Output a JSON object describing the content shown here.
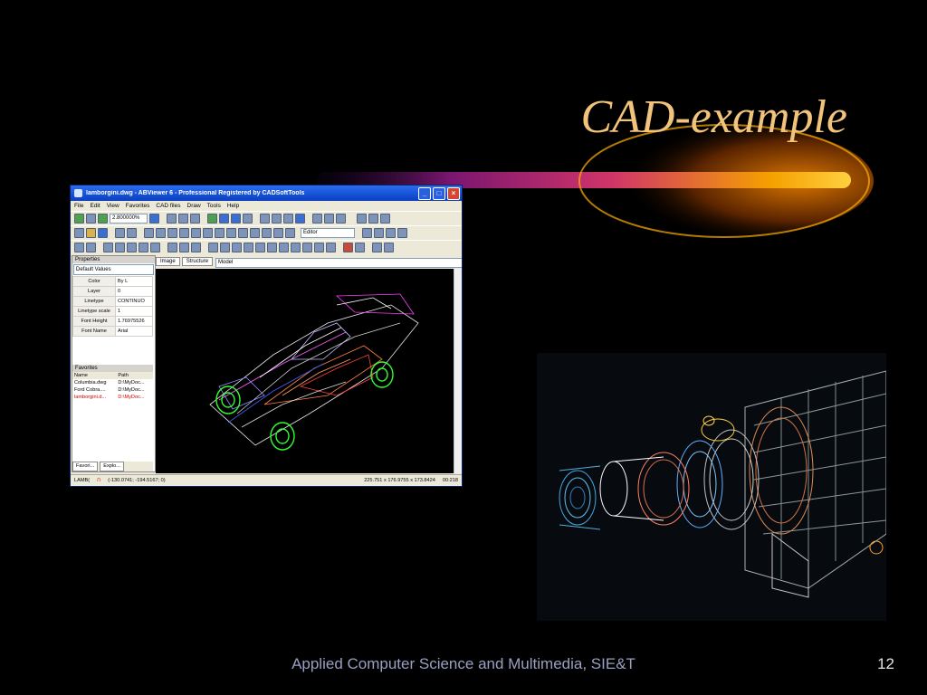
{
  "slide": {
    "title": "CAD-example",
    "footer": "Applied Computer Science and Multimedia, SIE&T",
    "page_number": "12"
  },
  "abviewer": {
    "window_title": "lamborgini.dwg - ABViewer 6 - Professional Registered by CADSoftTools",
    "menu": [
      "File",
      "Edit",
      "View",
      "Favorites",
      "CAD files",
      "Draw",
      "Tools",
      "Help"
    ],
    "zoom_value": "2.800000%",
    "mode_value": "Editor",
    "layout_value": "Model",
    "properties_header": "Properties",
    "properties_selector": "Default Values",
    "properties": [
      {
        "key": "Color",
        "value": "By L"
      },
      {
        "key": "Layer",
        "value": "0"
      },
      {
        "key": "Linetype",
        "value": "CONTINUO"
      },
      {
        "key": "Linetype scale",
        "value": "1"
      },
      {
        "key": "Font Height",
        "value": "1.76975526"
      },
      {
        "key": "Font Name",
        "value": "Arial"
      }
    ],
    "favorites_header": "Favorites",
    "favorites_columns": [
      "Name",
      "Path"
    ],
    "favorites_rows": [
      {
        "name": "Columbia.dwg",
        "path": "D:\\MyDoc..."
      },
      {
        "name": "Ford Cobra....",
        "path": "D:\\MyDoc..."
      },
      {
        "name": "lamborgini.d...",
        "path": "D:\\MyDoc..."
      }
    ],
    "bottom_tabs": [
      "Favori...",
      "Explo..."
    ],
    "drawing_tabs": [
      "Image",
      "Structure"
    ],
    "status_left": "LAMB(",
    "status_coords": "(-130.0741; -194.5167; 0)",
    "status_dims": "225.751 x 176.9755 x 173.8424",
    "status_time": "00:218"
  }
}
